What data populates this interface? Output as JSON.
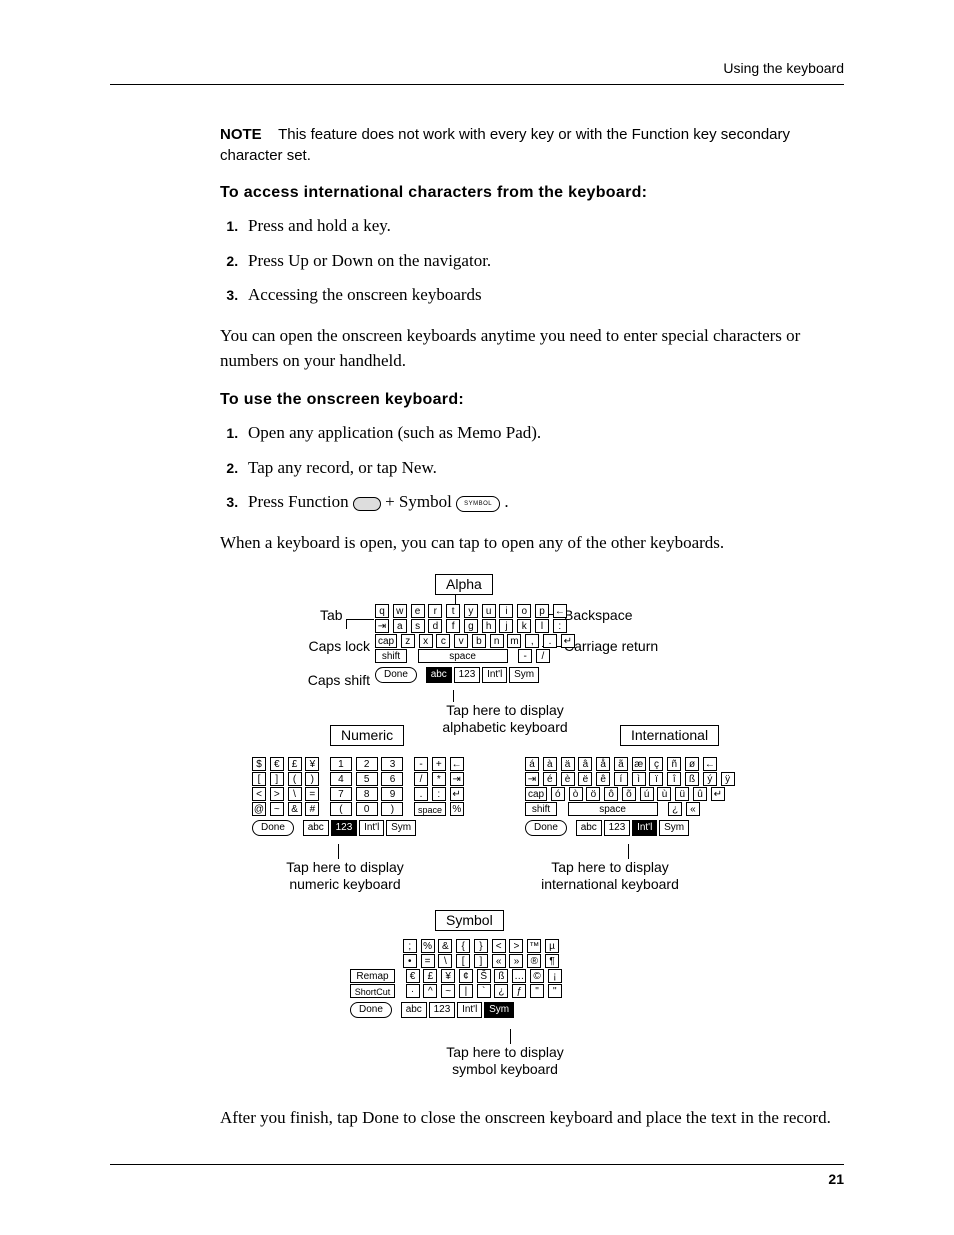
{
  "header": {
    "running_title": "Using the keyboard"
  },
  "note": {
    "label": "NOTE",
    "text": "This feature does not work with every key or with the Function key secondary character set."
  },
  "section1": {
    "heading": "To access international characters from the keyboard:",
    "steps": [
      "Press and hold a key.",
      "Press Up or Down on the navigator.",
      "Accessing the onscreen keyboards"
    ]
  },
  "para1": "You can open the onscreen keyboards anytime you need to enter special characters or numbers on your handheld.",
  "section2": {
    "heading": "To use the onscreen keyboard:",
    "step1": "Open any application (such as Memo Pad).",
    "step2": "Tap any record, or tap New.",
    "step3_prefix": "Press Function ",
    "step3_middle": " + Symbol ",
    "step3_suffix": ".",
    "symbol_key_label": "SYMBOL"
  },
  "para2": "When a keyboard is open, you can tap to open any of the other keyboards.",
  "diagram": {
    "labels": {
      "alpha": "Alpha",
      "tab": "Tab",
      "backspace": "Backspace",
      "caps_lock": "Caps lock",
      "carriage_return": "Carriage return",
      "caps_shift": "Caps shift",
      "numeric": "Numeric",
      "international": "International",
      "symbol": "Symbol"
    },
    "captions": {
      "alpha_caption": "Tap here to display\nalphabetic keyboard",
      "numeric_caption": "Tap here to display\nnumeric keyboard",
      "intl_caption": "Tap here to display\ninternational keyboard",
      "symbol_caption": "Tap here to display\nsymbol keyboard"
    },
    "common": {
      "done": "Done",
      "modes": {
        "abc": "abc",
        "n123": "123",
        "intl": "Int'l",
        "sym": "Sym"
      },
      "space": "space",
      "shift": "shift",
      "cap": "cap",
      "remap": "Remap",
      "shortcut": "ShortCut"
    },
    "alpha_kbd": {
      "row1": [
        "q",
        "w",
        "e",
        "r",
        "t",
        "y",
        "u",
        "i",
        "o",
        "p",
        "←"
      ],
      "row2": [
        "a",
        "s",
        "d",
        "f",
        "g",
        "h",
        "j",
        "k",
        "l",
        ":",
        "'"
      ],
      "row3": [
        "z",
        "x",
        "c",
        "v",
        "b",
        "n",
        "m",
        ",",
        ".",
        "↵"
      ],
      "row4_last": [
        "-",
        "/"
      ]
    },
    "numeric_kbd": {
      "currency_row": [
        "$",
        "€",
        "£",
        "¥"
      ],
      "brackets_row": [
        "[",
        "]",
        "(",
        ")"
      ],
      "compare_row": [
        "<",
        ">",
        "\\",
        "="
      ],
      "misc_row": [
        "@",
        "~",
        "&",
        "#"
      ],
      "digits": [
        [
          "1",
          "2",
          "3"
        ],
        [
          "4",
          "5",
          "6"
        ],
        [
          "7",
          "8",
          "9"
        ],
        [
          "(",
          "0",
          ")"
        ]
      ],
      "punct_col1": [
        "-",
        "+",
        "←"
      ],
      "punct_col2": [
        "/",
        "*"
      ],
      "punct_col3": [
        ".",
        ":",
        "↵"
      ],
      "last": [
        "space",
        "%"
      ]
    },
    "intl_kbd": {
      "row1": [
        "á",
        "à",
        "ä",
        "â",
        "å",
        "ã",
        "æ",
        "ç",
        "ñ",
        "ø",
        "←"
      ],
      "row2": [
        "é",
        "è",
        "ë",
        "ê",
        "í",
        "ì",
        "ï",
        "î",
        "ß",
        "ý",
        "ÿ"
      ],
      "row3": [
        "ó",
        "ò",
        "ö",
        "ô",
        "õ",
        "ú",
        "ù",
        "ü",
        "û",
        "↵"
      ],
      "row4_last": [
        "¿",
        "«"
      ]
    },
    "symbol_kbd": {
      "row1": [
        ";",
        "%",
        "&",
        "{",
        "}",
        "<",
        ">",
        "™",
        "µ"
      ],
      "row2": [
        "•",
        "=",
        "\\",
        "[",
        "]",
        "«",
        "»",
        "®",
        "¶"
      ],
      "row3": [
        "€",
        "£",
        "¥",
        "¢",
        "Š",
        "ß",
        "…",
        "©",
        "¡"
      ],
      "row4": [
        "·",
        "^",
        "~",
        "|",
        "`",
        "¿",
        "ƒ",
        "\"",
        "''"
      ]
    }
  },
  "para3": "After you finish, tap Done to close the onscreen keyboard and place the text in the record.",
  "page_number": "21"
}
